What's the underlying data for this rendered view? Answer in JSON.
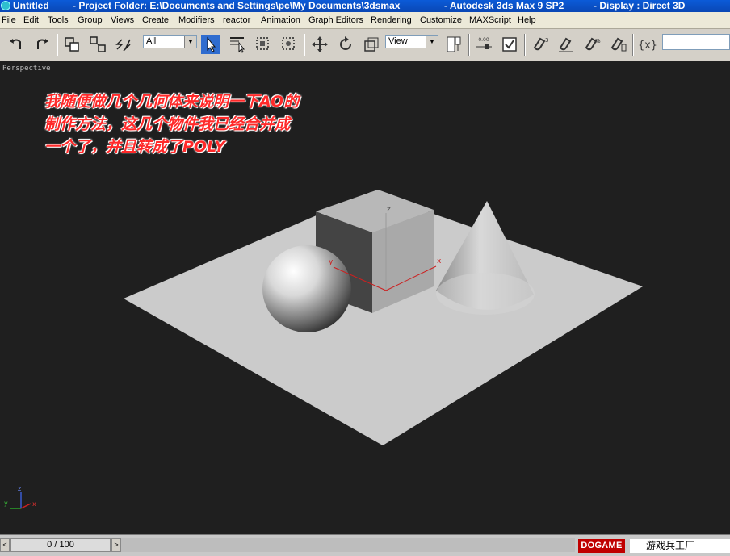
{
  "titlebar": {
    "app_title": "Untitled",
    "project": "- Project Folder: E:\\Documents and Settings\\pc\\My Documents\\3dsmax",
    "product": "- Autodesk 3ds Max 9 SP2",
    "display": "- Display : Direct 3D"
  },
  "menu": {
    "items": [
      "File",
      "Edit",
      "Tools",
      "Group",
      "Views",
      "Create",
      "Modifiers",
      "reactor",
      "Animation",
      "Graph Editors",
      "Rendering",
      "Customize",
      "MAXScript",
      "Help"
    ]
  },
  "toolbar": {
    "selection_filter": "All",
    "coord_system": "View",
    "spinner_value": "0.00"
  },
  "viewport": {
    "label": "Perspective",
    "annotation": [
      "我随便做几个几何体来说明一下AO的",
      "制作方法，这几个物件我已经合并成",
      "一个了，并且转成了POLY"
    ],
    "gizmo_axes": {
      "x": "x",
      "y": "y",
      "z": "z"
    },
    "corner_axes": {
      "x": "x",
      "y": "y",
      "z": "z"
    }
  },
  "timeline": {
    "frame_readout": "0 / 100",
    "prev_glyph": "<",
    "next_glyph": ">"
  },
  "watermark": {
    "brand": "DOGAME",
    "chinese": "游戏兵工厂"
  },
  "colors": {
    "title_blue": "#0a47b5",
    "annotation_red": "#ff2a2a",
    "viewport_bg": "#1f1f1f",
    "active_tool": "#2f6ccf"
  }
}
